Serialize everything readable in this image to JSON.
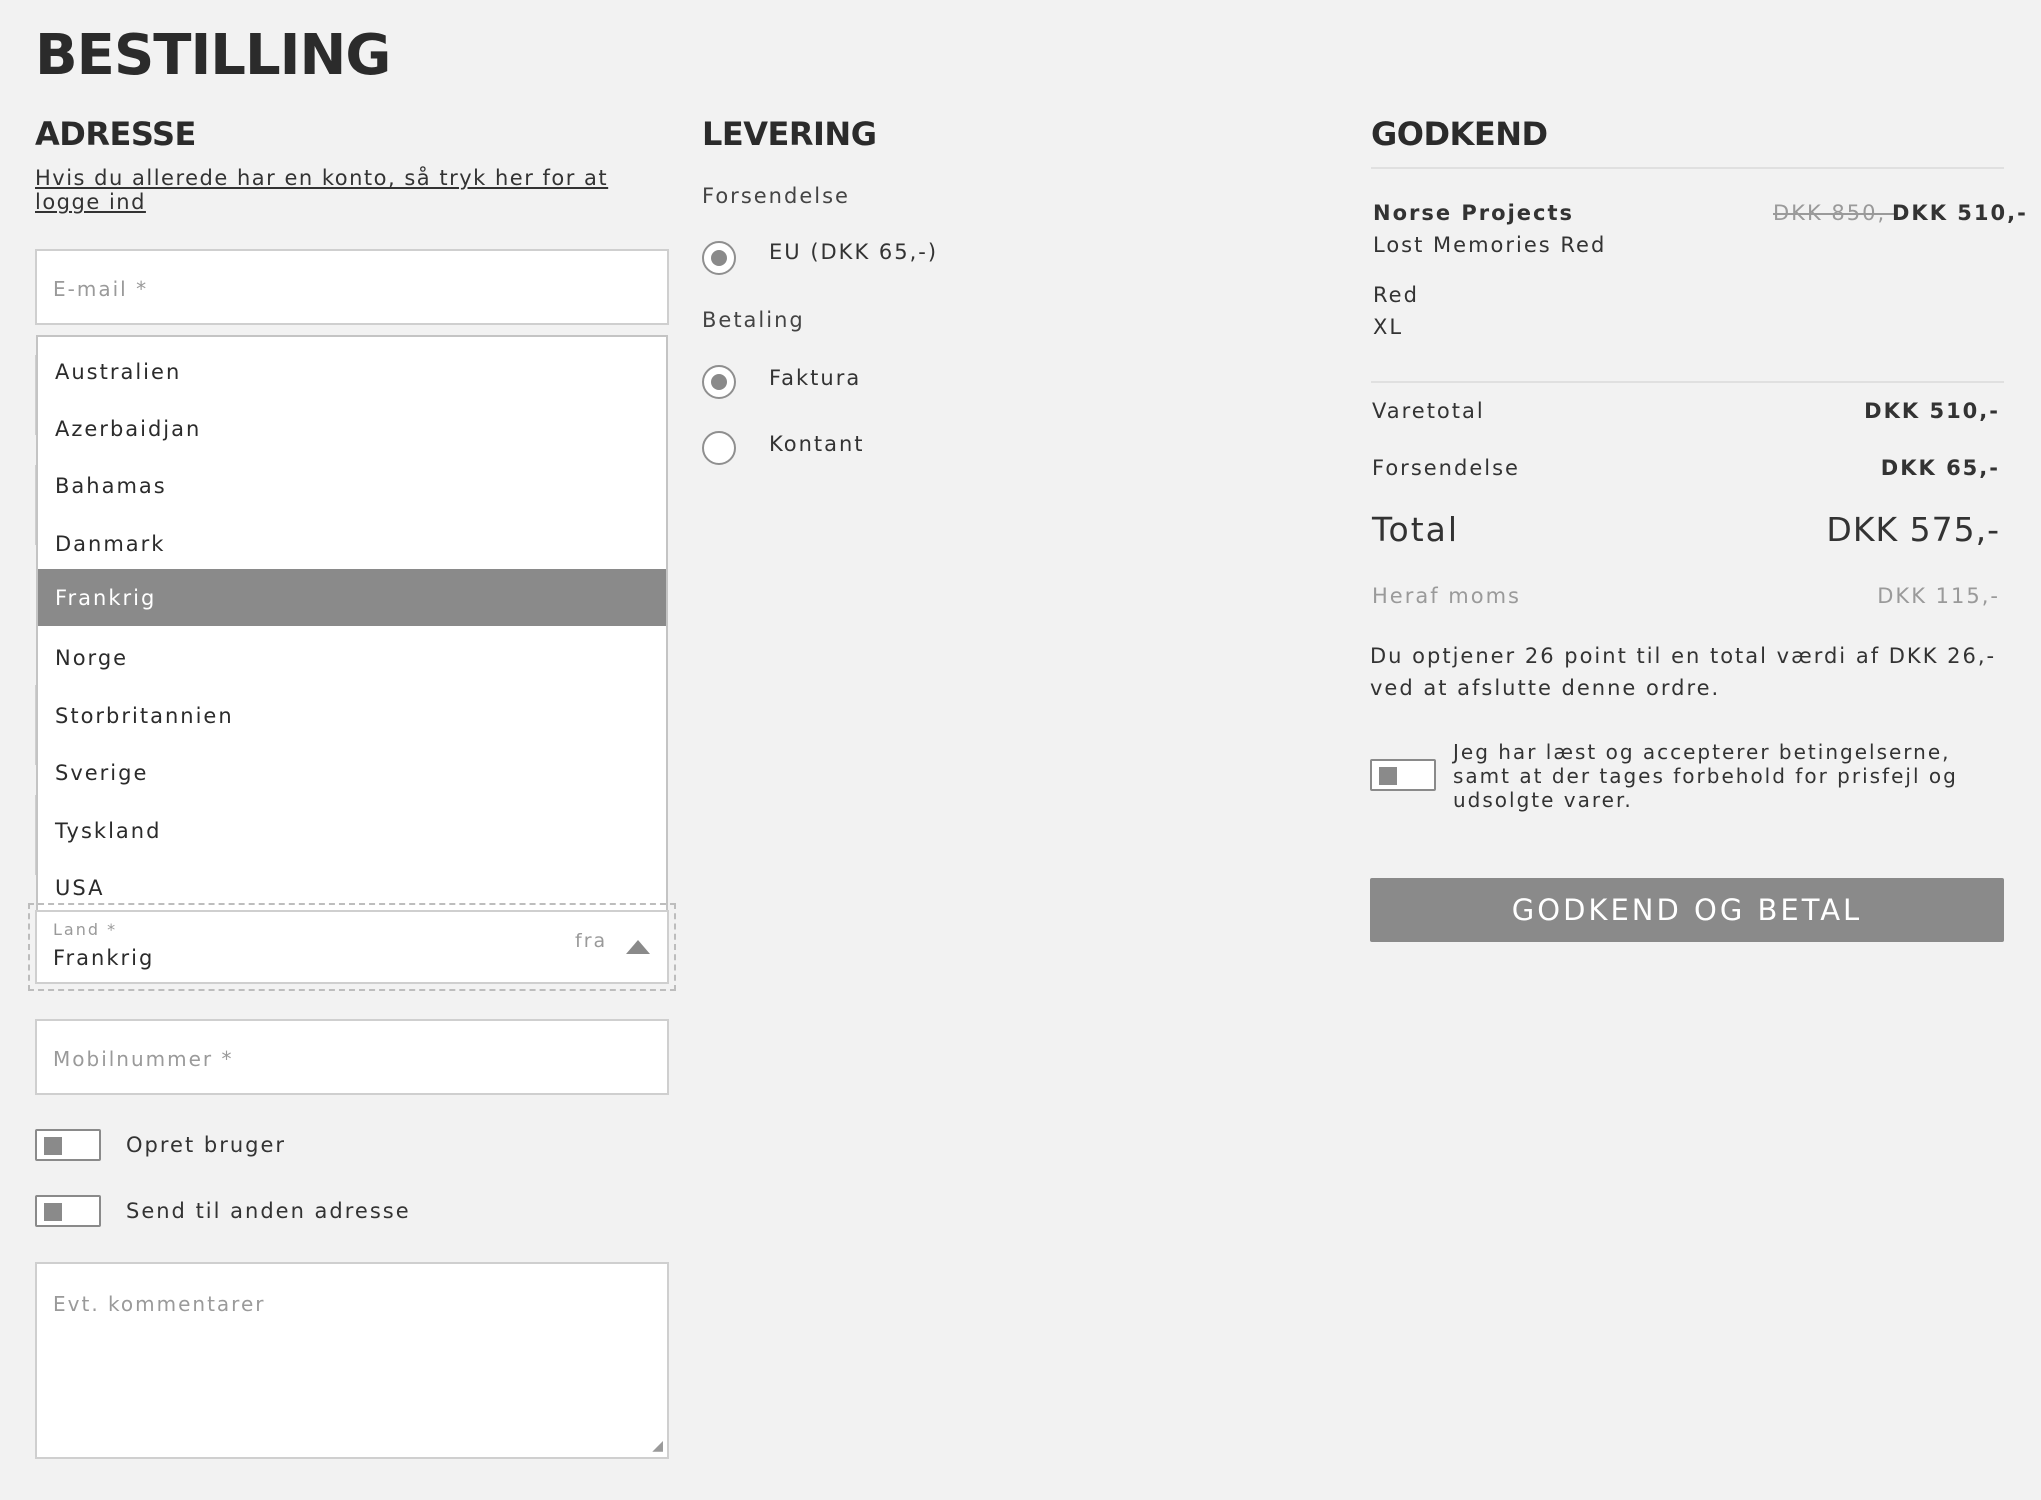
{
  "page": {
    "title": "BESTILLING"
  },
  "address": {
    "heading": "ADRESSE",
    "login_link": "Hvis du allerede har en konto, så tryk her for at logge ind",
    "email_placeholder": "E-mail *",
    "country_options": [
      "Australien",
      "Azerbaidjan",
      "Bahamas",
      "Danmark",
      "Frankrig",
      "Norge",
      "Storbritannien",
      "Sverige",
      "Tyskland",
      "USA"
    ],
    "country_selected_index": 4,
    "country_label": "Land *",
    "country_value": "Frankrig",
    "country_suffix": "fra",
    "phone_placeholder": "Mobilnummer *",
    "create_user_label": "Opret bruger",
    "other_address_label": "Send til anden adresse",
    "comments_placeholder": "Evt. kommentarer"
  },
  "delivery": {
    "heading": "LEVERING",
    "shipping_label": "Forsendelse",
    "shipping_option": "EU (DKK 65,-)",
    "payment_label": "Betaling",
    "payment_options": [
      "Faktura",
      "Kontant"
    ],
    "payment_selected": "Faktura"
  },
  "approve": {
    "heading": "GODKEND",
    "product": {
      "brand": "Norse Projects",
      "name": "Lost Memories Red",
      "old_price": "DKK 850,-",
      "price": "DKK 510,-",
      "color": "Red",
      "size": "XL"
    },
    "subtotal_label": "Varetotal",
    "subtotal_value": "DKK 510,-",
    "shipping_label": "Forsendelse",
    "shipping_value": "DKK 65,-",
    "total_label": "Total",
    "total_value": "DKK 575,-",
    "vat_label": "Heraf moms",
    "vat_value": "DKK 115,-",
    "points_line1": "Du optjener 26 point til en total værdi af DKK 26,-",
    "points_line2": "ved at afslutte denne ordre.",
    "terms_line1": "Jeg har læst og accepterer betingelserne,",
    "terms_line2": "samt at der tages forbehold for prisfejl og",
    "terms_line3": "udsolgte varer.",
    "submit_label": "GODKEND OG BETAL"
  },
  "colors": {
    "accent": "#8a8a8a",
    "background": "#f2f2f2",
    "text": "#333333"
  }
}
